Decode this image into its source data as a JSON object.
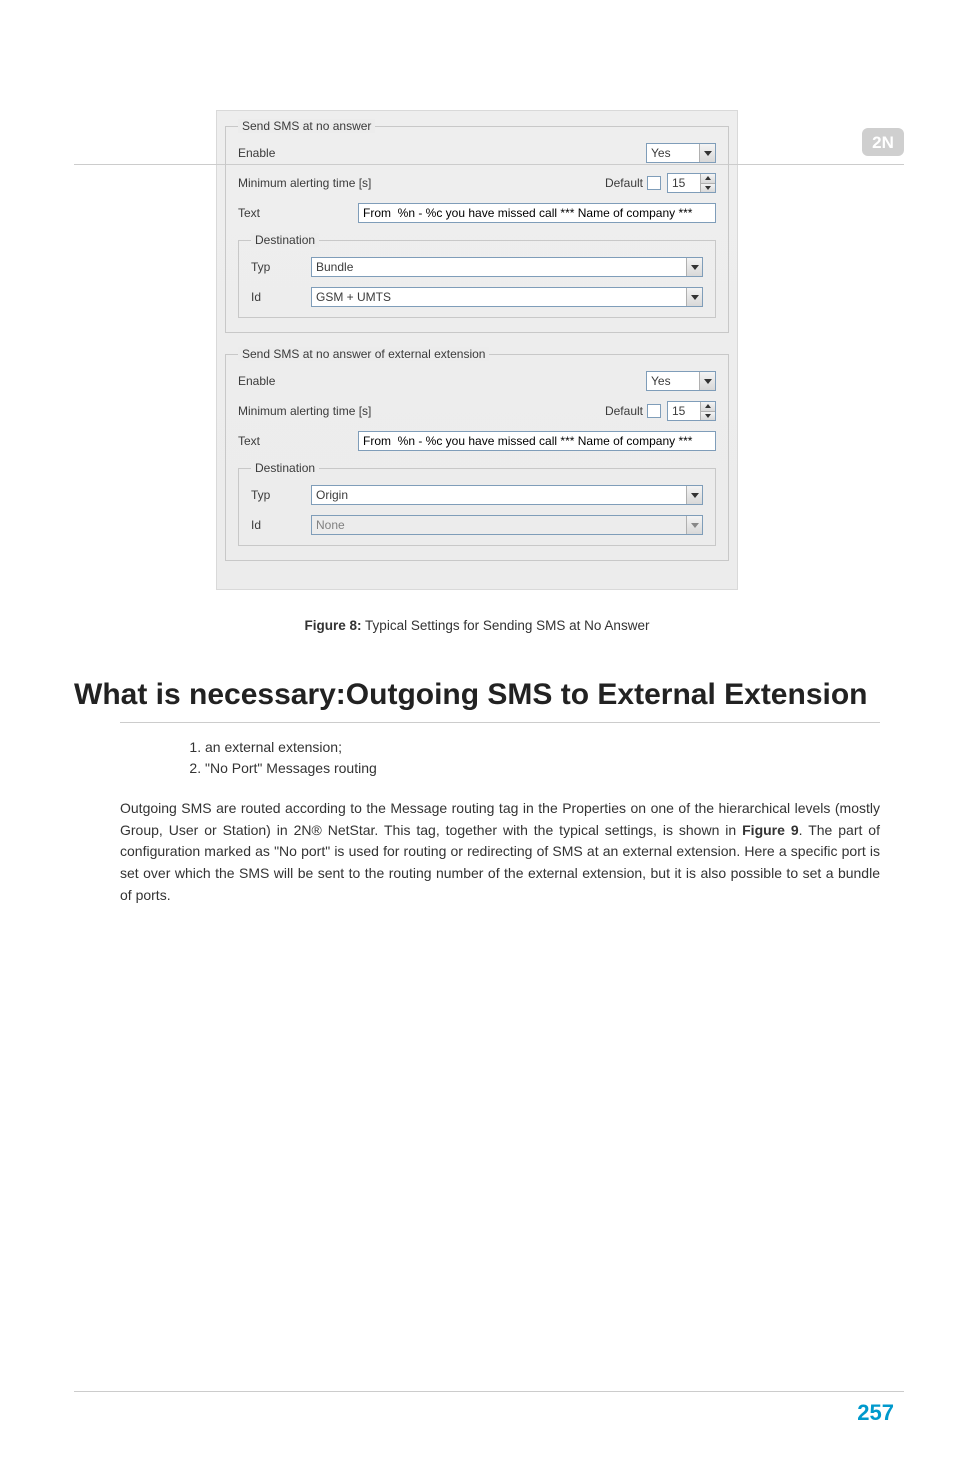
{
  "logo_alt": "2N",
  "panel": {
    "group1": {
      "legend": "Send SMS at no answer",
      "enable_label": "Enable",
      "enable_value": "Yes",
      "min_alert_label": "Minimum alerting time [s]",
      "default_label": "Default",
      "min_alert_value": "15",
      "text_label": "Text",
      "text_value": "From  %n - %c you have missed call *** Name of company ***",
      "dest_legend": "Destination",
      "typ_label": "Typ",
      "typ_value": "Bundle",
      "id_label": "Id",
      "id_value": "GSM + UMTS"
    },
    "group2": {
      "legend": "Send SMS at no answer of external extension",
      "enable_label": "Enable",
      "enable_value": "Yes",
      "min_alert_label": "Minimum alerting time [s]",
      "default_label": "Default",
      "min_alert_value": "15",
      "text_label": "Text",
      "text_value": "From  %n - %c you have missed call *** Name of company ***",
      "dest_legend": "Destination",
      "typ_label": "Typ",
      "typ_value": "Origin",
      "id_label": "Id",
      "id_value": "None"
    }
  },
  "caption": {
    "label": "Figure 8:",
    "text": " Typical Settings for Sending SMS at No Answer"
  },
  "heading": "What is necessary:Outgoing SMS to External Extension",
  "list": {
    "item1": "an external extension;",
    "item2": "\"No Port\" Messages routing"
  },
  "paragraph": {
    "p1a": "Outgoing SMS are routed according to the Message routing tag in the Properties on one of the hierarchical levels (mostly Group, User or Station) in 2N® NetStar. This tag, together with the typical settings, is shown in ",
    "p1b": "Figure 9",
    "p1c": ". The part of configuration marked as \"No port\" is used for routing or redirecting of SMS at an external extension. Here a specific port is set over which the SMS will be sent to the routing number of the external extension, but it is also possible to set a bundle of ports."
  },
  "page_number": "257"
}
